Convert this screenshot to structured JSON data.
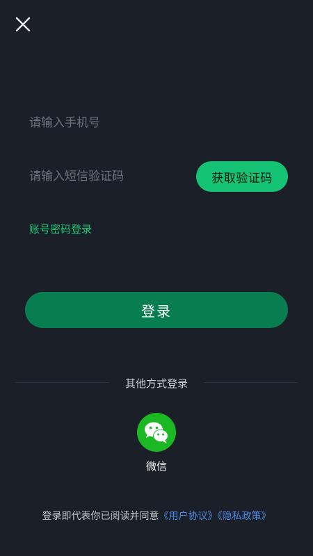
{
  "close": {
    "icon": "close-icon"
  },
  "form": {
    "phone_placeholder": "请输入手机号",
    "code_placeholder": "请输入短信验证码",
    "get_code_label": "获取验证码",
    "password_login_label": "账号密码登录",
    "login_label": "登录"
  },
  "other_login": {
    "title": "其他方式登录",
    "wechat_label": "微信",
    "wechat_icon": "wechat-icon"
  },
  "agreement": {
    "prefix": "登录即代表你已阅读并同意",
    "user_agreement": "《用户协议》",
    "privacy_policy": "《隐私政策》"
  },
  "colors": {
    "background": "#1b2028",
    "accent": "#14c374",
    "login_button": "#087d50",
    "link_blue": "#4d89e6",
    "wechat_green": "#1bb823"
  }
}
